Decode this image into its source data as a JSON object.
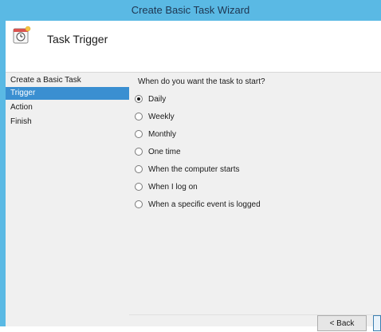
{
  "window": {
    "title": "Create Basic Task Wizard"
  },
  "header": {
    "heading": "Task Trigger",
    "icon": "calendar-clock-icon"
  },
  "steps": [
    "Create a Basic Task",
    "Trigger",
    "Action",
    "Finish"
  ],
  "active_step": "Trigger",
  "content": {
    "question": "When do you want the task to start?",
    "options": [
      "Daily",
      "Weekly",
      "Monthly",
      "One time",
      "When the computer starts",
      "When I log on",
      "When a specific event is logged"
    ],
    "selected": "Daily"
  },
  "buttons": {
    "back": "< Back",
    "next": ""
  },
  "colors": {
    "titlebar": "#5ab9e4",
    "active_step": "#3a8fd1"
  }
}
